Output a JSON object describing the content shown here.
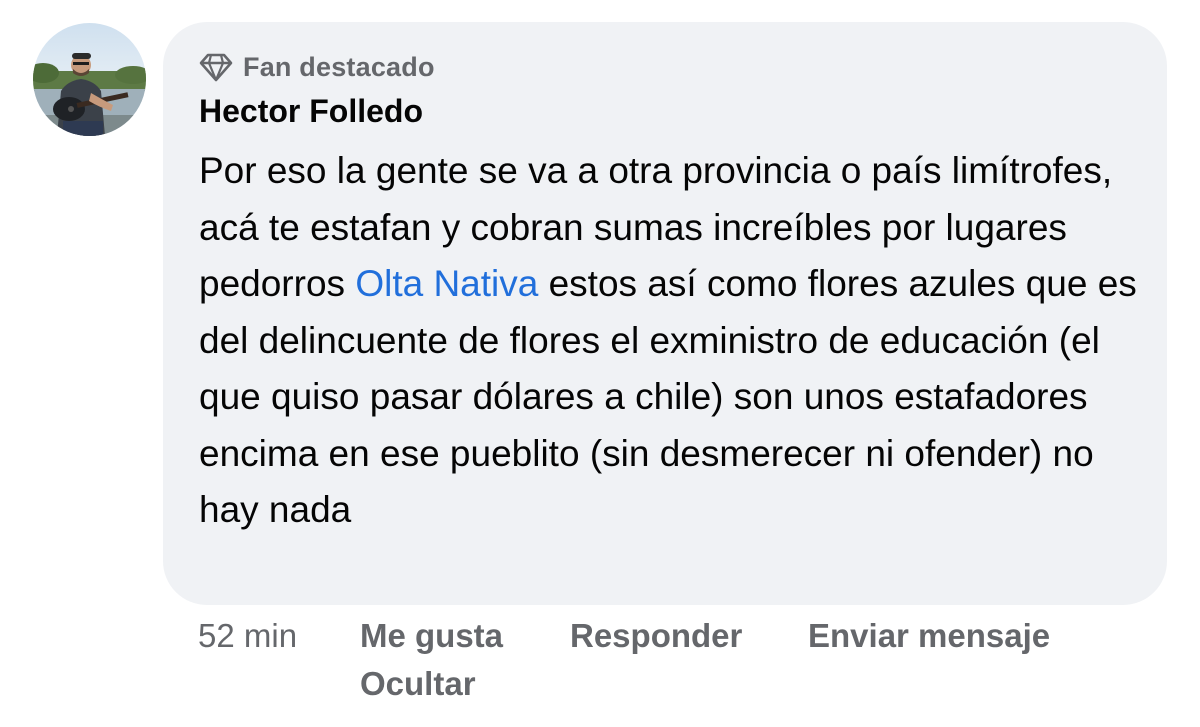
{
  "comment": {
    "badge": {
      "icon": "diamond-icon",
      "label": "Fan destacado"
    },
    "author": "Hector Folledo",
    "text_before_mention": "Por eso la gente se va a otra provincia o país limítrofes, acá te estafan y cobran sumas increíbles por lugares pedorros ",
    "mention": "Olta Nativa",
    "text_after_mention": " estos así como flores azules que es del delincuente de flores el exministro de educación (el que quiso pasar dólares a chile) son unos estafadores encima en ese pueblito (sin desmerecer ni ofender) no hay nada",
    "avatar": "profile-photo-man-with-guitar"
  },
  "actions": {
    "timestamp": "52 min",
    "like": "Me gusta",
    "reply": "Responder",
    "send_message": "Enviar mensaje",
    "hide": "Ocultar"
  },
  "colors": {
    "bubble_bg": "#f0f2f5",
    "text": "#050505",
    "secondary": "#65676b",
    "mention": "#216fdb"
  }
}
